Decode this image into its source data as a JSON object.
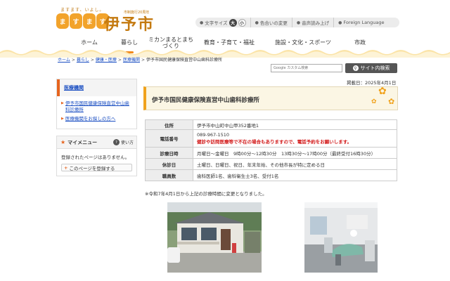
{
  "logo": {
    "tagline": "ますます、いよし。",
    "glyphs": [
      "ま",
      "す",
      "ま",
      "す"
    ],
    "city_name": "伊予市",
    "seal": "市制施行20周年"
  },
  "utility": {
    "font_size_label": "文字サイズ",
    "font_large": "大",
    "font_small": "小",
    "color_change": "色合いの変更",
    "read_aloud": "音声読み上げ",
    "foreign_language": "Foreign Language"
  },
  "gnav": {
    "items": [
      {
        "label": "ホーム"
      },
      {
        "label": "暮らし"
      },
      {
        "label": "ミカンまるとまちづくり"
      },
      {
        "label": "教育・子育て・福祉"
      },
      {
        "label": "施設・文化・スポーツ"
      },
      {
        "label": "市政"
      }
    ]
  },
  "breadcrumb": {
    "items": [
      "ホーム",
      "暮らし",
      "健康・医療",
      "医療機関"
    ],
    "current": "伊予市国民健康保険直営中山歯科診療所"
  },
  "search": {
    "placeholder": "Google カスタム検索",
    "button": "サイト内検索"
  },
  "sidebar": {
    "heading": "医療機関",
    "links": [
      "伊予市国民健康保険直営中山歯科診療所",
      "医療機関をお探しの方へ"
    ]
  },
  "mymenu": {
    "title": "マイメニュー",
    "help": "使い方",
    "empty": "登録されたページはありません。",
    "register": "このページを登録する"
  },
  "main": {
    "published": "掲載日：2025年4月1日",
    "title": "伊予市国民健康保険直営中山歯科診療所",
    "table": {
      "address_label": "住所",
      "address": "伊予市中山町中山甲352番地1",
      "phone_label": "電話番号",
      "phone": "089-967-1510",
      "phone_warning": "健診や訪問医療等で不在の場合もありますので、電話予約をお願いします。",
      "hours_label": "診療日時",
      "hours": "月曜日～金曜日　9時00分～12時30分　13時30分～17時00分（最終受付16時30分）",
      "holidays_label": "休診日",
      "holidays": "土曜日、日曜日、祝日、年末年始、その他市長が特に定める日",
      "staff_label": "職員数",
      "staff": "歯科医師1名、歯科衛生士3名、受付1名"
    },
    "note": "※令和7年4月1日から上記の診療時間に変更となりました。"
  },
  "colors": {
    "accent_orange": "#f0a21c",
    "link_blue": "#1a4ec2",
    "warning_red": "#d21818"
  }
}
